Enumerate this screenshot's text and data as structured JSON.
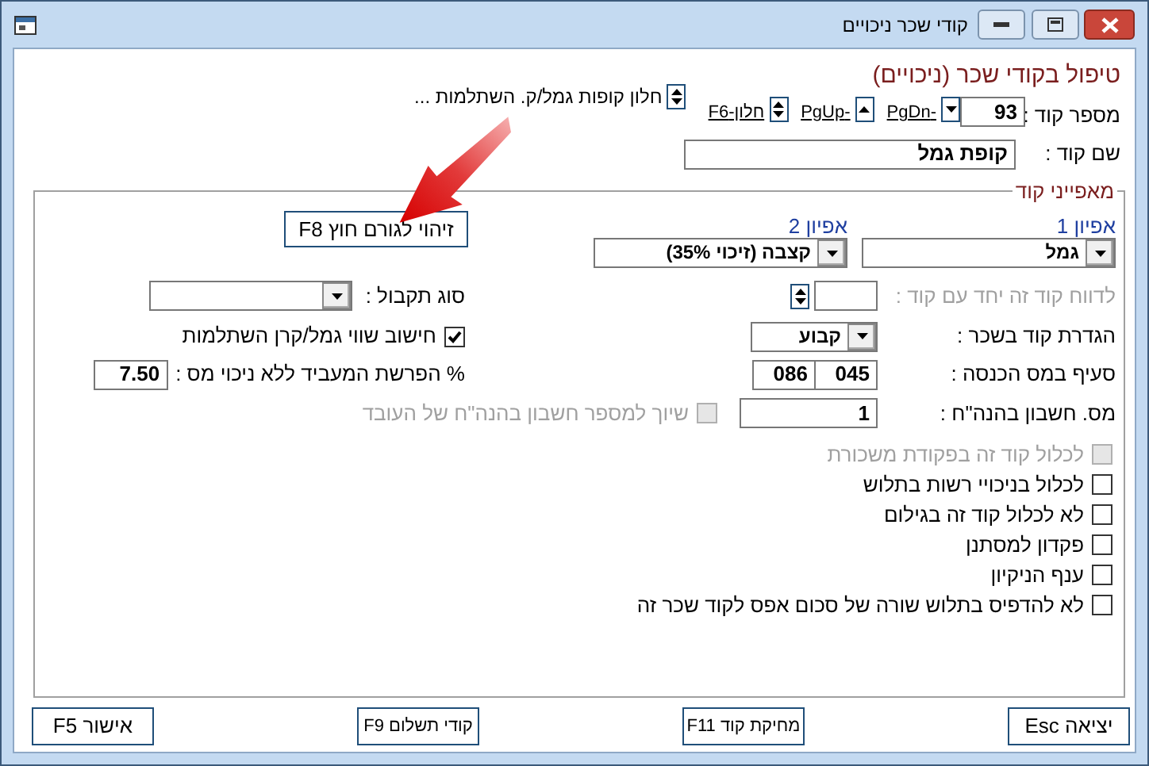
{
  "window": {
    "title": "קודי שכר ניכויים"
  },
  "heading": "טיפול בקודי שכר (ניכויים)",
  "code_number": {
    "label": "מספר קוד :",
    "value": "93"
  },
  "nav": [
    {
      "kind": "down",
      "label": "-PgDn"
    },
    {
      "kind": "up",
      "label": "-PgUp"
    },
    {
      "kind": "spin",
      "label": "חלון-F6"
    }
  ],
  "funds_window": {
    "label": "חלון קופות גמל/ק. השתלמות ..."
  },
  "code_name": {
    "label": "שם קוד :",
    "value": "קופת גמל"
  },
  "properties": {
    "title": "מאפייני קוד",
    "type_1": {
      "label": "אפיון 1",
      "value": "גמל"
    },
    "type_2": {
      "label": "אפיון 2",
      "value": "קצבה (זיכוי 35%)"
    },
    "external_id_button": "זיהוי לגורם חוץ F8",
    "report_with_code": {
      "label": "לדווח קוד זה יחד עם קוד :",
      "disabled": true
    },
    "receipt_type": {
      "label": "סוג תקבול :"
    },
    "salary_definition": {
      "label": "הגדרת קוד בשכר :",
      "value": "קבוע"
    },
    "pension_calc": {
      "label": "חישוב שווי גמל/קרן השתלמות",
      "checked": true
    },
    "tax_clause": {
      "label": "סעיף במס הכנסה :",
      "values": [
        "045",
        "086"
      ]
    },
    "employer_percent": {
      "label": "% הפרשת המעביד ללא ניכוי מס :",
      "value": "7.50"
    },
    "ledger_account": {
      "label": "מס. חשבון בהנה\"ח :",
      "value": "1"
    },
    "employee_account_link": {
      "label": "שיוך למספר חשבון בהנה\"ח של העובד",
      "checked": false,
      "disabled": true
    },
    "options": [
      {
        "label": "לכלול קוד זה בפקודת משכורת",
        "checked": false,
        "disabled": true
      },
      {
        "label": "לכלול בניכויי רשות בתלוש",
        "checked": false,
        "disabled": false
      },
      {
        "label": "לא לכלול קוד זה בגילום",
        "checked": false,
        "disabled": false
      },
      {
        "label": "פקדון למסתנן",
        "checked": false,
        "disabled": false
      },
      {
        "label": "ענף הניקיון",
        "checked": false,
        "disabled": false
      },
      {
        "label": "לא להדפיס בתלוש שורה של סכום אפס לקוד שכר זה",
        "checked": false,
        "disabled": false
      }
    ]
  },
  "buttons": [
    {
      "label": "יציאה Esc"
    },
    {
      "label": "מחיקת קוד F11"
    },
    {
      "label": "קודי תשלום F9"
    },
    {
      "label": "אישור F5"
    }
  ]
}
